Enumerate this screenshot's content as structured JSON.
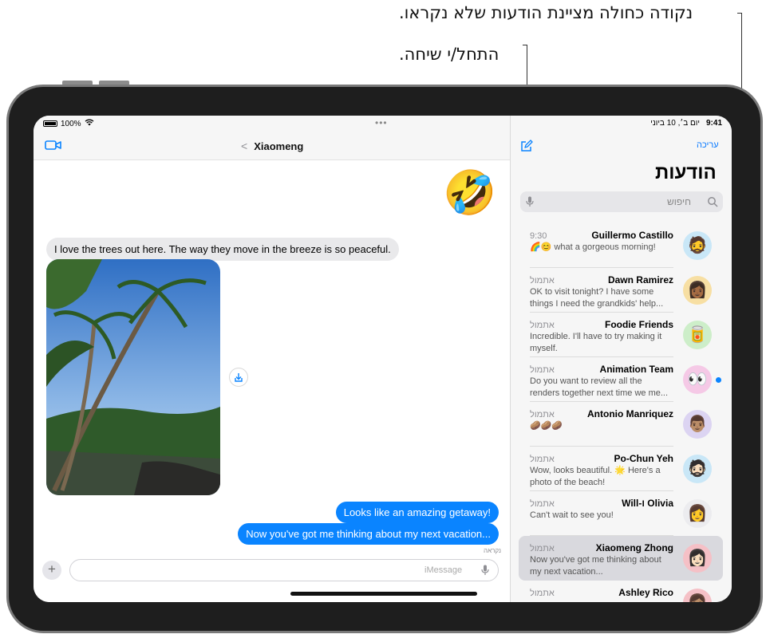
{
  "callouts": {
    "unread_dot": "נקודה כחולה מציינת הודעות שלא נקראו.",
    "compose": "התחל/י שיחה."
  },
  "status_bar": {
    "battery": "100%",
    "time": "9:41",
    "date": "יום ב׳, 10 ביוני"
  },
  "conversation": {
    "contact_name": "Xiaomeng",
    "back_glyph": "<",
    "multitask_dots": "•••",
    "emoji": "🤣",
    "messages": [
      {
        "from": "them",
        "text": "I love the trees out here. The way they move in the breeze is so peaceful."
      },
      {
        "from": "me",
        "text": "Looks like an amazing getaway!"
      },
      {
        "from": "me",
        "text": "Now you've got me thinking about my next vacation..."
      }
    ],
    "read_receipt": "נקראה",
    "input_placeholder": "iMessage",
    "plus_label": "+"
  },
  "sidebar": {
    "edit_label": "עריכה",
    "title": "הודעות",
    "search_placeholder": "חיפוש",
    "conversations": [
      {
        "name": "Guillermo Castillo",
        "time": "9:30",
        "preview": "🌈😊 what a gorgeous morning!",
        "avatar": "🧔",
        "avatar_color": "#c9e7f7",
        "unread": false,
        "selected": false
      },
      {
        "name": "Dawn Ramirez",
        "time": "אתמול",
        "preview": "OK to visit tonight? I have some things I need the grandkids' help...",
        "avatar": "👩🏾",
        "avatar_color": "#f7dfa3",
        "unread": false,
        "selected": false
      },
      {
        "name": "Foodie Friends",
        "time": "אתמול",
        "preview": "Incredible. I'll have to try making it myself.",
        "avatar": "🥫",
        "avatar_color": "#cdeec9",
        "unread": false,
        "selected": false
      },
      {
        "name": "Animation Team",
        "time": "אתמול",
        "preview": "Do you want to review all the renders together next time we me...",
        "avatar": "👀",
        "avatar_color": "#f5c9e6",
        "unread": true,
        "selected": false
      },
      {
        "name": "Antonio Manriquez",
        "time": "אתמול",
        "preview": "🥔🥔🥔",
        "avatar": "👨🏽",
        "avatar_color": "#dcd4f2",
        "unread": false,
        "selected": false
      },
      {
        "name": "Po-Chun Yeh",
        "time": "אתמול",
        "preview": "Wow, looks beautiful. 🌟 Here's a photo of the beach!",
        "avatar": "🧔🏻",
        "avatar_color": "#c9e7f7",
        "unread": false,
        "selected": false
      },
      {
        "name": "Will-ו Olivia",
        "time": "אתמול",
        "preview": "Can't wait to see you!",
        "avatar": "👩",
        "avatar_color": "#ececef",
        "unread": false,
        "selected": false
      },
      {
        "name": "Xiaomeng Zhong",
        "time": "אתמול",
        "preview": "Now you've got me thinking about my next vacation...",
        "avatar": "👩🏻",
        "avatar_color": "#f5c0c6",
        "unread": false,
        "selected": true
      },
      {
        "name": "Ashley Rico",
        "time": "אתמול",
        "preview": "",
        "avatar": "👩🏽",
        "avatar_color": "#f5c0c6",
        "unread": false,
        "selected": false
      }
    ]
  },
  "colors": {
    "accent_blue": "#0a84ff",
    "bubble_gray": "#e9e9eb",
    "sidebar_bg": "#f6f6f6"
  }
}
